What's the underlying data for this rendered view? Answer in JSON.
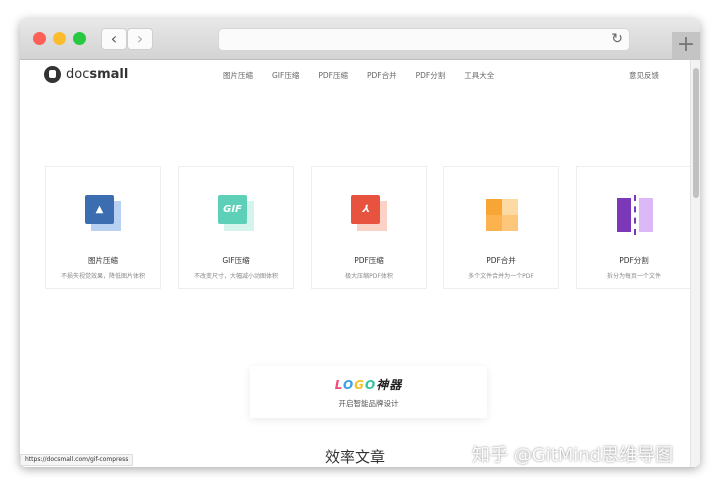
{
  "browser": {
    "back": "‹",
    "forward": "›",
    "reload": "↻",
    "new_tab": "+"
  },
  "header": {
    "logo_light": "doc",
    "logo_bold": "small",
    "nav": [
      "图片压缩",
      "GIF压缩",
      "PDF压缩",
      "PDF合并",
      "PDF分割",
      "工具大全"
    ],
    "feedback": "意见反馈"
  },
  "tools": [
    {
      "title": "图片压缩",
      "desc": "不损失视觉效果，降低图片体积",
      "color": "#3c6db0",
      "back": "#b8d0f2",
      "icon": "image-icon"
    },
    {
      "title": "GIF压缩",
      "desc": "不改变尺寸，大幅减小动图体积",
      "color": "#5fd0b8",
      "back": "#d4f4ec",
      "icon": "gif-icon",
      "glyph": "GIF"
    },
    {
      "title": "PDF压缩",
      "desc": "极大压缩PDF体积",
      "color": "#e8533f",
      "back": "#fbd3c6",
      "icon": "pdf-icon"
    },
    {
      "title": "PDF合并",
      "desc": "多个文件合并为一个PDF",
      "color": "#f7a535",
      "back": "#fdd9a3",
      "icon": "puzzle-icon"
    },
    {
      "title": "PDF分割",
      "desc": "拆分为每页一个文件",
      "color": "#7b38b8",
      "back": "#dcb8f7",
      "icon": "split-icon"
    }
  ],
  "promo": {
    "logo_letters": [
      "L",
      "O",
      "G",
      "O"
    ],
    "logo_colors": [
      "#ee4a7a",
      "#3aa0e8",
      "#f5c22e",
      "#36c1a0"
    ],
    "logo_suffix": "神器",
    "subtitle": "开启智能品牌设计"
  },
  "articles_heading": "效率文章",
  "status_url": "https://docsmall.com/gif-compress",
  "watermark": "知乎 @GitMind思维导图"
}
